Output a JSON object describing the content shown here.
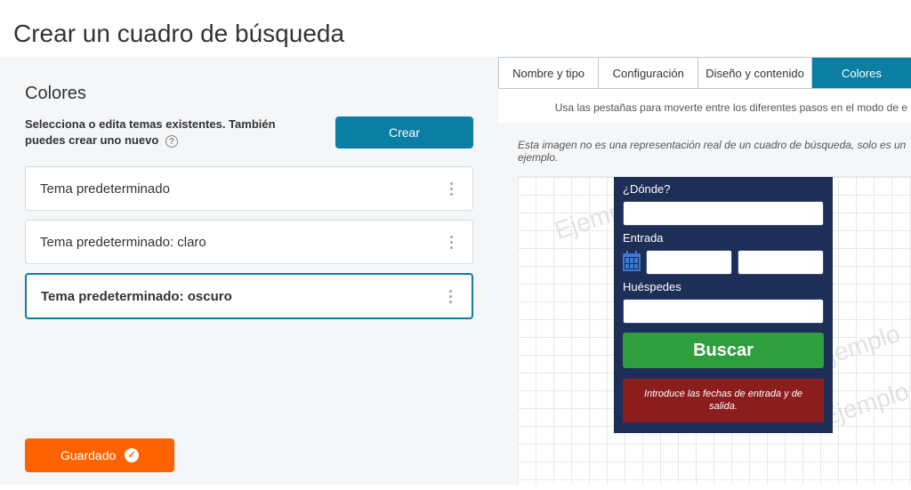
{
  "page": {
    "title": "Crear un cuadro de búsqueda"
  },
  "tabs": {
    "items": [
      {
        "label": "Nombre y tipo"
      },
      {
        "label": "Configuración"
      },
      {
        "label": "Diseño y contenido"
      },
      {
        "label": "Colores"
      }
    ],
    "hint": "Usa las pestañas para moverte entre los diferentes pasos en el modo de e"
  },
  "left": {
    "section_title": "Colores",
    "instruction": "Selecciona o edita temas existentes. También puedes crear uno nuevo",
    "create_label": "Crear",
    "themes": [
      {
        "label": "Tema predeterminado"
      },
      {
        "label": "Tema predeterminado: claro"
      },
      {
        "label": "Tema predeterminado: oscuro"
      }
    ],
    "save_label": "Guardado"
  },
  "preview": {
    "caption": "Esta imagen no es una representación real de un cuadro de búsqueda, solo es un ejemplo.",
    "donde": "¿Dónde?",
    "entrada": "Entrada",
    "huespedes": "Huéspedes",
    "buscar": "Buscar",
    "error": "Introduce las fechas de entrada y de salida.",
    "watermark": "Ejemplo"
  },
  "colors": {
    "accent": "#0a7ea3",
    "save": "#ff6200",
    "panel_bg": "#f4f6f8",
    "searchbox_bg": "#1d2e57",
    "search_btn": "#2f9e3f",
    "error_bg": "#8c1d1d"
  }
}
